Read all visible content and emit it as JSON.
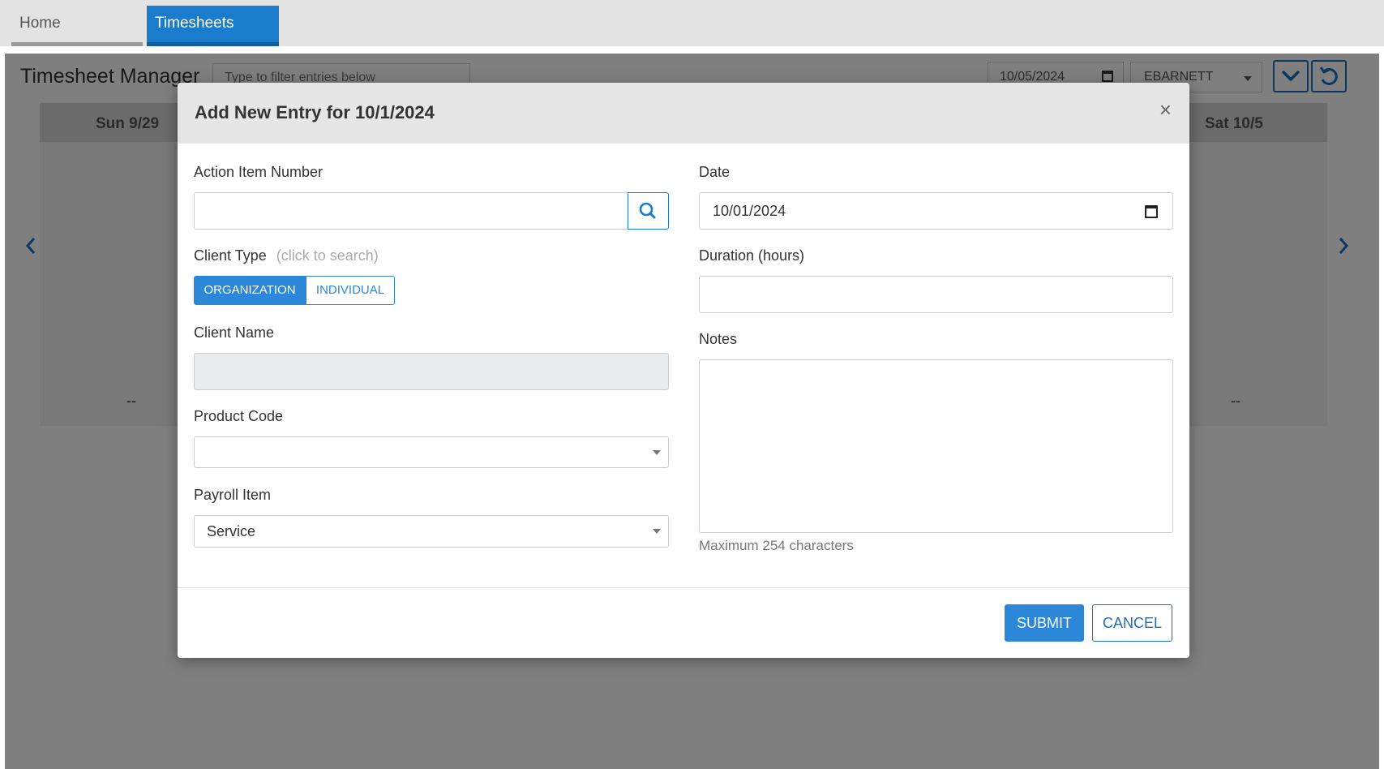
{
  "nav": {
    "tabs": [
      {
        "label": "Home",
        "active": false
      },
      {
        "label": "Timesheets",
        "active": true
      }
    ]
  },
  "background": {
    "title": "Timesheet Manager",
    "filter_placeholder": "Type to filter entries below",
    "week_date": "10/05/2024",
    "user": "EBARNETT",
    "days": {
      "first": "Sun 9/29",
      "last": "Sat 10/5"
    },
    "empty_value": "--"
  },
  "modal": {
    "title": "Add New Entry for 10/1/2024",
    "close_glyph": "×",
    "action_item": {
      "label": "Action Item Number",
      "value": ""
    },
    "client_type": {
      "label": "Client Type",
      "hint": "(click to search)",
      "options": [
        "ORGANIZATION",
        "INDIVIDUAL"
      ],
      "selected": "ORGANIZATION"
    },
    "client_name": {
      "label": "Client Name",
      "value": ""
    },
    "product_code": {
      "label": "Product Code",
      "value": ""
    },
    "payroll_item": {
      "label": "Payroll Item",
      "value": "Service"
    },
    "date": {
      "label": "Date",
      "value": "10/01/2024"
    },
    "duration": {
      "label": "Duration (hours)",
      "value": ""
    },
    "notes": {
      "label": "Notes",
      "value": "",
      "help": "Maximum 254 characters"
    },
    "buttons": {
      "submit": "SUBMIT",
      "cancel": "CANCEL"
    }
  },
  "colors": {
    "primary": "#2c87d8",
    "nav_active": "#1a7ccc",
    "overlay": "rgba(0,0,0,0.5)"
  }
}
